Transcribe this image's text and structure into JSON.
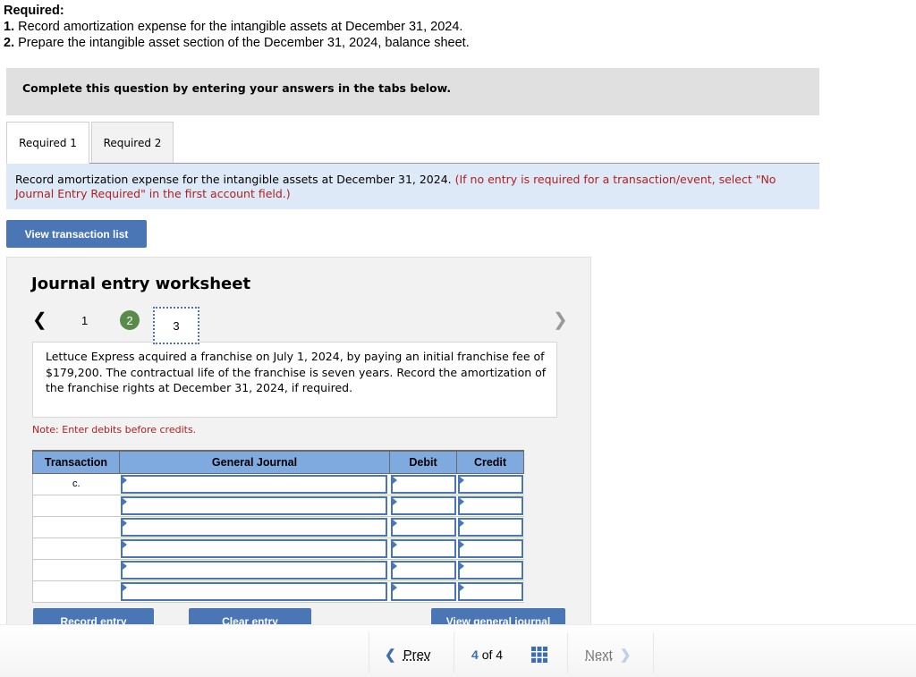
{
  "required": {
    "title": "Required:",
    "items": [
      {
        "num": "1.",
        "text": " Record amortization expense for the intangible assets at December 31, 2024."
      },
      {
        "num": "2.",
        "text": " Prepare the intangible asset section of the December 31, 2024, balance sheet."
      }
    ]
  },
  "instructions": "Complete this question by entering your answers in the tabs below.",
  "tabs": [
    {
      "label": "Required 1",
      "active": true
    },
    {
      "label": "Required 2",
      "active": false
    }
  ],
  "prompt": {
    "text": "Record amortization expense for the intangible assets at December 31, 2024. ",
    "hint": "(If no entry is required for a transaction/event, select \"No Journal Entry Required\" in the first account field.)"
  },
  "buttons": {
    "view_transaction_list": "View transaction list",
    "record_entry": "Record entry",
    "clear_entry": "Clear entry",
    "view_general_journal": "View general journal"
  },
  "worksheet": {
    "title": "Journal entry worksheet",
    "pages": [
      "1",
      "2",
      "3"
    ],
    "completed_page": "2",
    "current_page": "3",
    "prev_icon": "chevron-left-icon",
    "next_icon": "chevron-right-icon",
    "scenario": "Lettuce Express acquired a franchise on July 1, 2024, by paying an initial franchise fee of $179,200. The contractual life of the franchise is seven years. Record the amortization of the franchise rights at December 31, 2024, if required.",
    "note": "Note: Enter debits before credits."
  },
  "journal": {
    "headers": [
      "Transaction",
      "General Journal",
      "Debit",
      "Credit"
    ],
    "rows": [
      {
        "transaction": "c.",
        "account": "",
        "debit": "",
        "credit": ""
      },
      {
        "transaction": "",
        "account": "",
        "debit": "",
        "credit": ""
      },
      {
        "transaction": "",
        "account": "",
        "debit": "",
        "credit": ""
      },
      {
        "transaction": "",
        "account": "",
        "debit": "",
        "credit": ""
      },
      {
        "transaction": "",
        "account": "",
        "debit": "",
        "credit": ""
      },
      {
        "transaction": "",
        "account": "",
        "debit": "",
        "credit": ""
      }
    ]
  },
  "bottom_nav": {
    "prev_label": "Prev",
    "next_label": "Next",
    "current": "4",
    "of_label": "of",
    "total": "4",
    "prev_icon": "chevron-left-icon",
    "next_icon": "chevron-right-icon",
    "grid_icon": "grid-icon",
    "accent_color": "#3b6eb5"
  }
}
